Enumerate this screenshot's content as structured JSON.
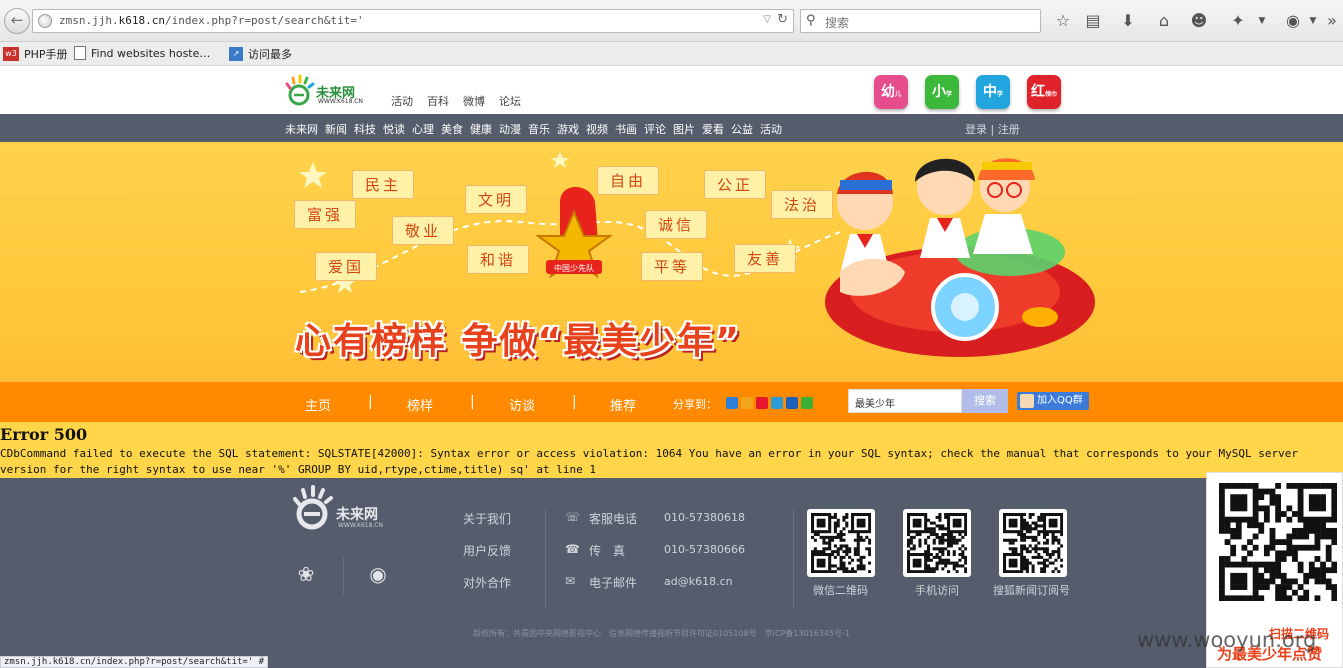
{
  "browser": {
    "url_prefix": "zmsn.jjh.",
    "url_domain": "k618.cn",
    "url_suffix": "/index.php?r=post/search&tit='",
    "search_placeholder": "搜索",
    "bookmarks": [
      {
        "label": "PHP手册",
        "icon": "w3-icon",
        "color": "#c9302c"
      },
      {
        "label": "Find websites hoste…",
        "icon": "page-icon",
        "color": "#777777"
      },
      {
        "label": "访问最多",
        "icon": "most-visited-icon",
        "color": "#3a78c8"
      }
    ],
    "status_url": "zmsn.jjh.k618.cn/index.php?r=post/search&tit=' #"
  },
  "site": {
    "logo_name": "未来网",
    "logo_sub": "WWW.K618.CN",
    "top_links": [
      "活动",
      "百科",
      "微博",
      "论坛"
    ],
    "badges": [
      {
        "label": "幼",
        "sub": "儿",
        "color": "#e54d8d"
      },
      {
        "label": "小",
        "sub": "学",
        "color": "#3bb83a"
      },
      {
        "label": "中",
        "sub": "学",
        "color": "#22a4df"
      },
      {
        "label": "红",
        "sub": "领巾",
        "color": "#e0232b"
      }
    ],
    "main_nav": [
      "未来网",
      "新闻",
      "科技",
      "悦读",
      "心理",
      "美食",
      "健康",
      "动漫",
      "音乐",
      "游戏",
      "视频",
      "书画",
      "评论",
      "图片",
      "爱看",
      "公益",
      "活动"
    ],
    "login": "登录",
    "login_sep": "|",
    "register": "注册"
  },
  "banner": {
    "values": [
      "民主",
      "富强",
      "敬业",
      "文明",
      "和谐",
      "自由",
      "诚信",
      "平等",
      "公正",
      "法治",
      "友善",
      "爱国"
    ],
    "emblem_text": "中国少先队",
    "slogan": "心有榜样 争做“最美少年”"
  },
  "subnav": {
    "items": [
      "主页",
      "榜样",
      "访谈",
      "推荐"
    ],
    "separator": "|",
    "share_label": "分享到：",
    "share_icons": [
      {
        "name": "share-plus-icon",
        "color": "#2f7ed8"
      },
      {
        "name": "share-qzone-icon",
        "color": "#f2a51b"
      },
      {
        "name": "share-weibo-icon",
        "color": "#e6162d"
      },
      {
        "name": "share-tencent-icon",
        "color": "#2a9bd6"
      },
      {
        "name": "share-renren-icon",
        "color": "#1d5fb8"
      },
      {
        "name": "share-wechat-icon",
        "color": "#3cb034"
      }
    ],
    "search_value": "最美少年",
    "search_button": "搜索",
    "qq_group": "加入QQ群"
  },
  "error": {
    "title": "Error 500",
    "message": "CDbCommand failed to execute the SQL statement: SQLSTATE[42000]: Syntax error or access violation: 1064 You have an error in your SQL syntax; check the manual that corresponds to your MySQL server version for the right syntax to use near '%' GROUP BY uid,rtype,ctime,title) sq' at line 1"
  },
  "footer": {
    "logo_name": "未来网",
    "logo_sub": "WWW.K618.CN",
    "links": [
      "关于我们",
      "用户反馈",
      "对外合作"
    ],
    "contacts": [
      {
        "label": "客服电话",
        "value": "010-57380618",
        "icon": "phone-icon",
        "glyph": "☏"
      },
      {
        "label": "传　真",
        "value": "010-57380666",
        "icon": "fax-icon",
        "glyph": "☎"
      },
      {
        "label": "电子邮件",
        "value": "ad@k618.cn",
        "icon": "mail-icon",
        "glyph": "✉"
      }
    ],
    "qr_codes": [
      {
        "caption": "微信二维码"
      },
      {
        "caption": "手机访问"
      },
      {
        "caption": "搜狐新闻订阅号"
      }
    ],
    "copyright": "版权所有：共青团中央网络影视中心　信息网络传播视听节目许可证0105108号　京ICP备13016345号-1"
  },
  "side_ad": {
    "line1": "扫描二维码",
    "line2": "为最美少年点赞"
  },
  "watermark": "www.wooyun.org"
}
